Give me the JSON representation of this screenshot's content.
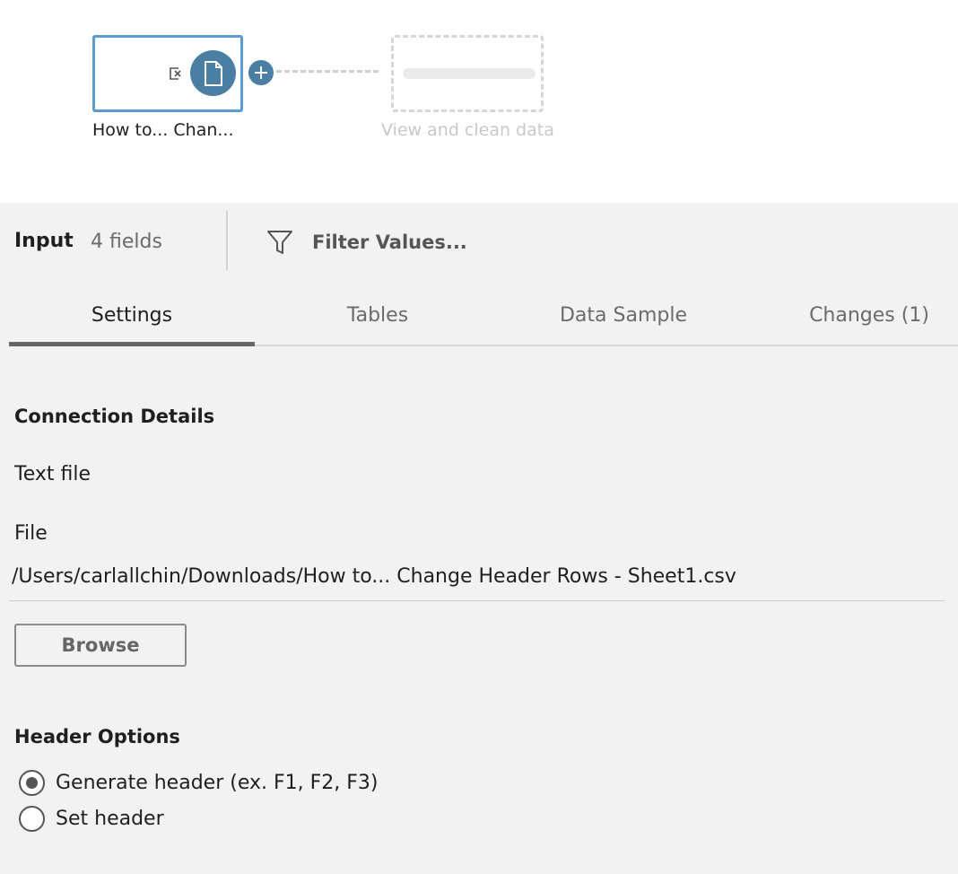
{
  "flow": {
    "input_node_label": "How to... Chan...",
    "placeholder_node_label": "View and clean data",
    "icons": {
      "remove": "remove-step-icon",
      "file": "file-icon",
      "add": "plus-icon"
    },
    "colors": {
      "node_border": "#5b9bd5",
      "badge": "#4a7ea3",
      "placeholder": "#d6d6d6"
    }
  },
  "panel": {
    "step_title": "Input",
    "field_count": "4 fields",
    "filter_label": "Filter Values...",
    "filter_icon": "funnel-icon"
  },
  "tabs": [
    {
      "label": "Settings",
      "active": true
    },
    {
      "label": "Tables",
      "active": false
    },
    {
      "label": "Data Sample",
      "active": false
    },
    {
      "label": "Changes (1)",
      "active": false
    }
  ],
  "settings": {
    "connection_details_title": "Connection Details",
    "connection_type": "Text file",
    "file_label": "File",
    "file_path": "/Users/carlallchin/Downloads/How to... Change Header Rows - Sheet1.csv",
    "browse_label": "Browse",
    "header_options_title": "Header Options",
    "header_options": [
      {
        "label": "Generate header (ex. F1, F2, F3)",
        "selected": true
      },
      {
        "label": "Set header",
        "selected": false
      }
    ]
  }
}
